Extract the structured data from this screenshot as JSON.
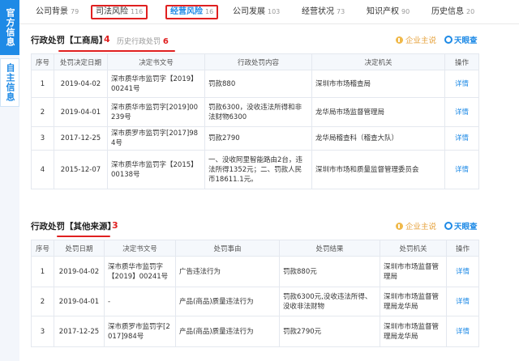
{
  "side_tabs": {
    "active": "官方信息",
    "inactive": "自主信息"
  },
  "nav": [
    {
      "label": "公司背景",
      "count": "79"
    },
    {
      "label": "司法风险",
      "count": "116"
    },
    {
      "label": "经营风险",
      "count": "16"
    },
    {
      "label": "公司发展",
      "count": "103"
    },
    {
      "label": "经营状况",
      "count": "73"
    },
    {
      "label": "知识产权",
      "count": "90"
    },
    {
      "label": "历史信息",
      "count": "20"
    }
  ],
  "section1": {
    "title": "行政处罚【工商局】",
    "mark": "4",
    "history_label": "历史行政处罚",
    "history_count": "6",
    "headers": [
      "序号",
      "处罚决定日期",
      "决定书文号",
      "行政处罚内容",
      "决定机关",
      "操作"
    ],
    "rows": [
      [
        "1",
        "2019-04-02",
        "深市质华市监罚字【2019】00241号",
        "罚款880",
        "深圳市市场稽查局",
        "详情"
      ],
      [
        "2",
        "2019-04-01",
        "深市质华市监罚字[2019]00239号",
        "罚款6300，没收违法所得和非法财物6300",
        "龙华局市场监督管理局",
        "详情"
      ],
      [
        "3",
        "2017-12-25",
        "深市质罗市监罚字[2017]984号",
        "罚款2790",
        "龙华局稽查科（稽查大队）",
        "详情"
      ],
      [
        "4",
        "2015-12-07",
        "深市质华市监罚字【2015】00138号",
        "一、没收阿里智能路由2台，违法所得1352元；二、罚款人民币18611.1元。",
        "深圳市市场和质量监督管理委员会",
        "详情"
      ]
    ]
  },
  "section2": {
    "title": "行政处罚【其他来源】",
    "mark": "3",
    "headers": [
      "序号",
      "处罚日期",
      "决定书文号",
      "处罚事由",
      "处罚结果",
      "处罚机关",
      "操作"
    ],
    "rows": [
      [
        "1",
        "2019-04-02",
        "深市质华市监罚字【2019】00241号",
        "广告违法行为",
        "罚款880元",
        "深圳市市场监督管理局",
        "详情"
      ],
      [
        "2",
        "2019-04-01",
        "-",
        "产品(商品)质量违法行为",
        "罚款6300元,没收违法所得、没收非法财物",
        "深圳市市场监督管理局龙华局",
        "详情"
      ],
      [
        "3",
        "2017-12-25",
        "深市质罗市监罚字[2017]984号",
        "产品(商品)质量违法行为",
        "罚款2790元",
        "深圳市市场监督管理局龙华局",
        "详情"
      ]
    ]
  },
  "tools": {
    "zhu_label": "企业主说",
    "tyc_label": "天眼查"
  },
  "colors": {
    "accent": "#1e8ae6",
    "annotation_red": "#e02020",
    "header_bg": "#f5f8fc"
  }
}
